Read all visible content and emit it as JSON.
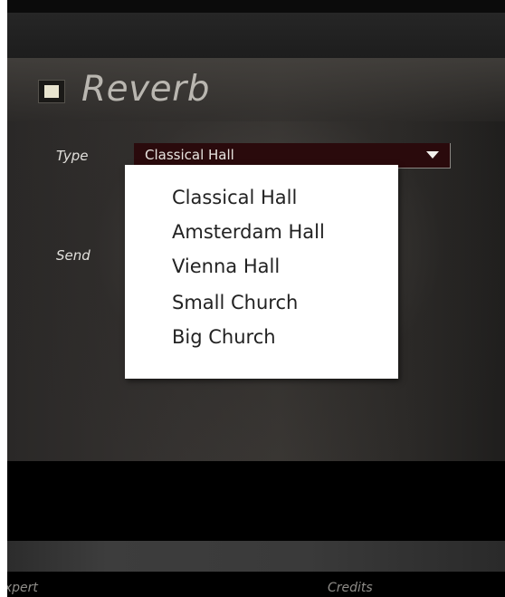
{
  "section": {
    "title": "Reverb",
    "enabled": true
  },
  "fields": {
    "type_label": "Type",
    "send_label": "Send"
  },
  "type_dropdown": {
    "selected": "Classical Hall",
    "options": [
      "Classical Hall",
      "Amsterdam Hall",
      "Vienna Hall",
      "Small Church",
      "Big Church"
    ]
  },
  "footer": {
    "expert_label": "Expert",
    "credits_label": "Credits"
  },
  "colors": {
    "toggle_fill": "#e8e4cf",
    "dropdown_bg": "#2a0a0c",
    "title_text": "#b9b6b0"
  }
}
